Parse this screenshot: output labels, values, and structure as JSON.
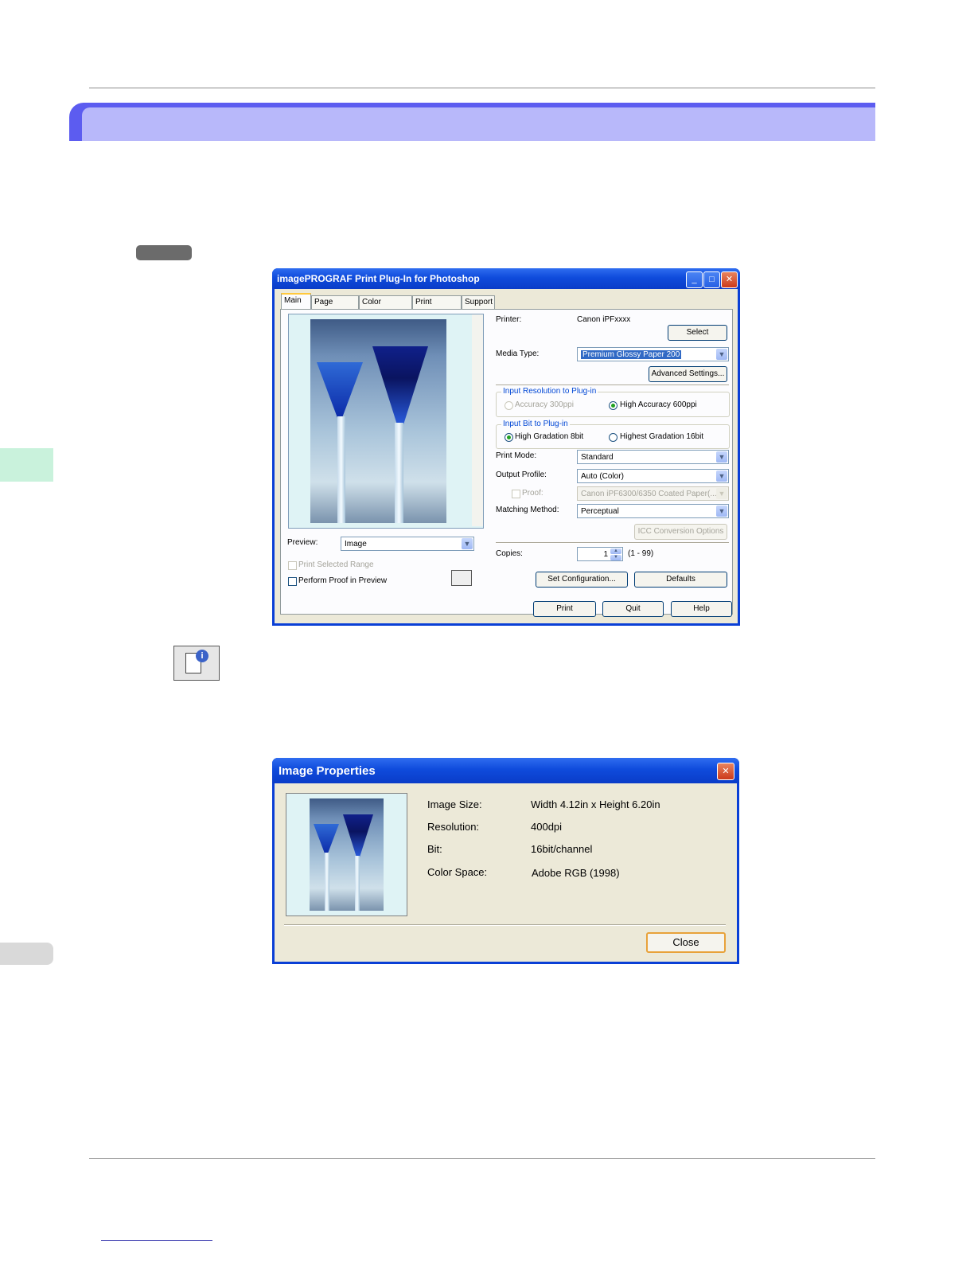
{
  "plugin_dialog": {
    "title": "imagePROGRAF Print Plug-In for Photoshop",
    "tabs": [
      "Main",
      "Page Setup",
      "Color Settings",
      "Print History",
      "Support"
    ],
    "printer_label": "Printer:",
    "printer_value": "Canon iPFxxxx",
    "select_button": "Select",
    "media_type_label": "Media Type:",
    "media_type_value": "Premium Glossy Paper 200",
    "advanced_settings_button": "Advanced Settings...",
    "input_resolution_group": "Input Resolution to Plug-in",
    "res_option_1": "Accuracy 300ppi",
    "res_option_2": "High Accuracy 600ppi",
    "input_bit_group": "Input Bit to Plug-in",
    "bit_option_1": "High Gradation 8bit",
    "bit_option_2": "Highest Gradation 16bit",
    "print_mode_label": "Print Mode:",
    "print_mode_value": "Standard",
    "output_profile_label": "Output Profile:",
    "output_profile_value": "Auto (Color)",
    "proof_label": "Proof:",
    "proof_value": "Canon iPF6300/6350 Coated Paper(...",
    "matching_method_label": "Matching Method:",
    "matching_method_value": "Perceptual",
    "icc_button": "ICC Conversion Options",
    "copies_label": "Copies:",
    "copies_value": "1",
    "copies_range": "(1 - 99)",
    "preview_label": "Preview:",
    "preview_value": "Image",
    "print_selected_range": "Print Selected Range",
    "perform_proof": "Perform Proof in Preview",
    "set_configuration_button": "Set Configuration...",
    "defaults_button": "Defaults",
    "print_button": "Print",
    "quit_button": "Quit",
    "help_button": "Help"
  },
  "image_properties": {
    "title": "Image Properties",
    "rows": [
      {
        "label": "Image Size:",
        "value": "Width 4.12in x Height 6.20in"
      },
      {
        "label": "Resolution:",
        "value": "400dpi"
      },
      {
        "label": "Bit:",
        "value": "16bit/channel"
      },
      {
        "label": "Color Space:",
        "value": "Adobe RGB (1998)"
      }
    ],
    "close_button": "Close"
  },
  "colors": {
    "xp_title_blue": "#0f4bdc",
    "section_band": "#b8b8fa",
    "dialog_face": "#ece9d8"
  }
}
